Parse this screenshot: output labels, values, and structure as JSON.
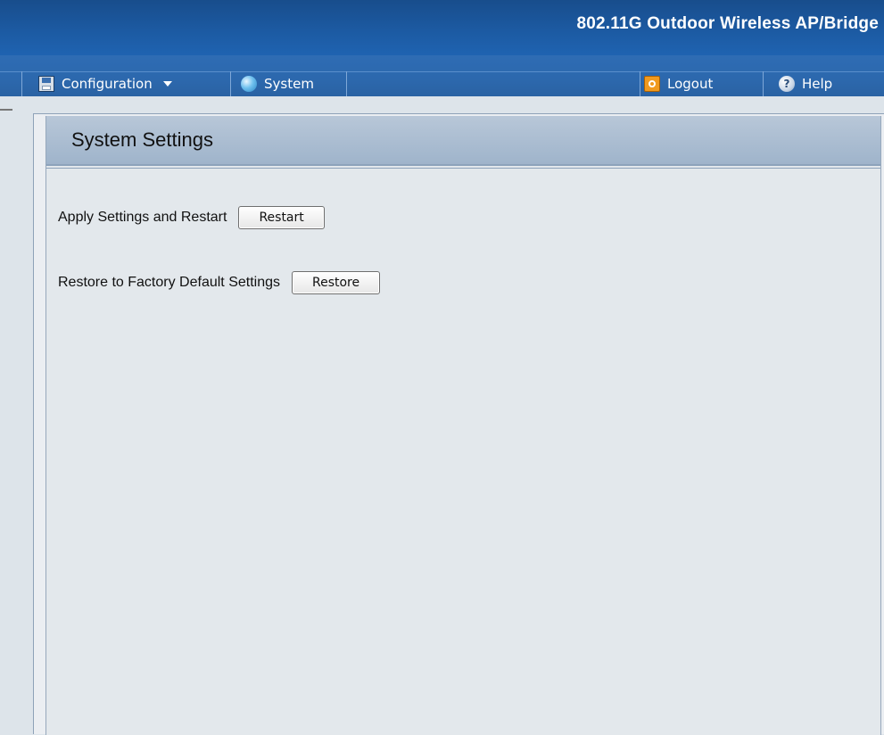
{
  "banner": {
    "product_title": "802.11G Outdoor Wireless AP/Bridge"
  },
  "menubar": {
    "configuration_label": "Configuration",
    "system_label": "System",
    "logout_label": "Logout",
    "help_label": "Help"
  },
  "page": {
    "title": "System Settings",
    "rows": [
      {
        "label": "Apply Settings and Restart",
        "button": "Restart"
      },
      {
        "label": "Restore to Factory Default Settings",
        "button": "Restore"
      }
    ]
  }
}
